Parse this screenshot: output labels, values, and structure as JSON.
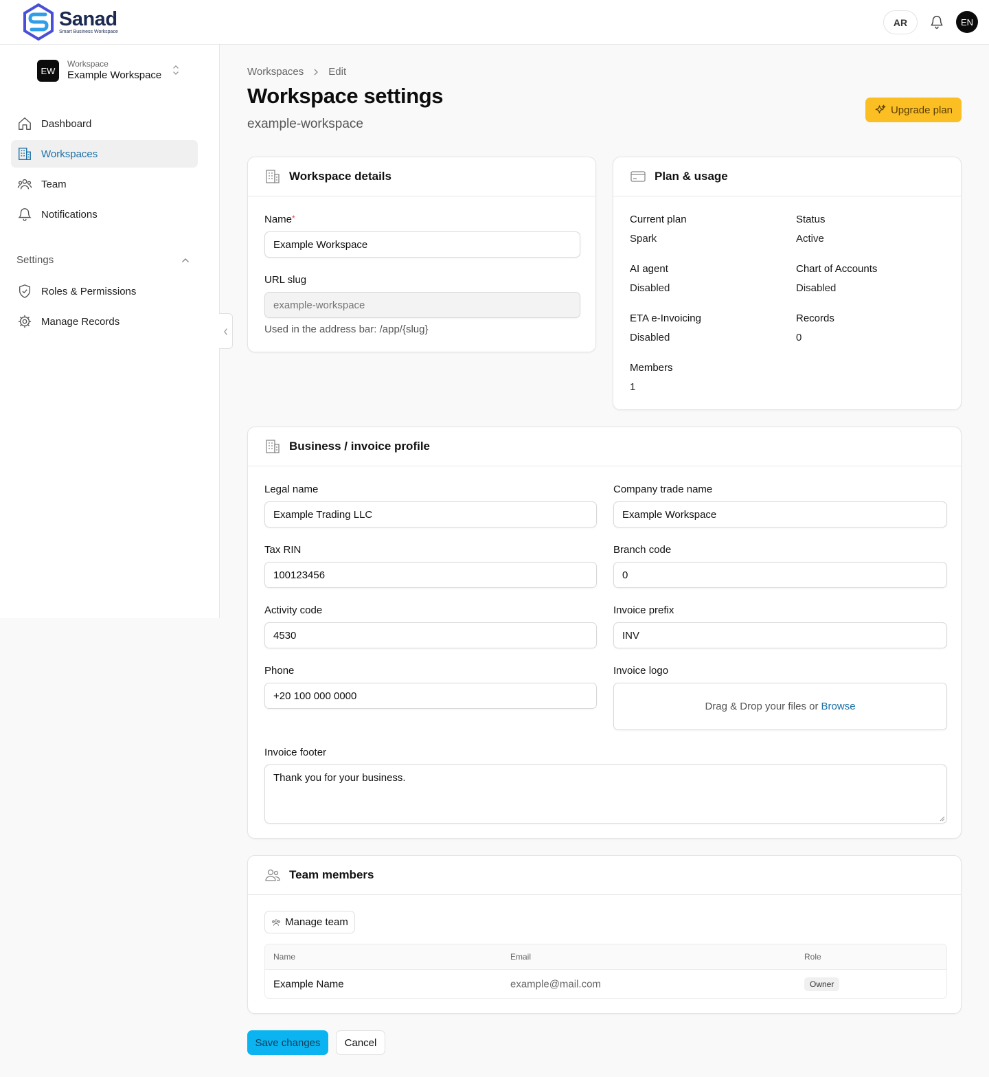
{
  "brand": {
    "name": "Sanad",
    "tagline": "Smart Business Workspace"
  },
  "topbar": {
    "lang_button": "AR",
    "user_initials": "EN"
  },
  "sidebar": {
    "workspace_label": "Workspace",
    "workspace_name": "Example Workspace",
    "workspace_initials": "EW",
    "nav": [
      {
        "label": "Dashboard",
        "icon": "home-icon"
      },
      {
        "label": "Workspaces",
        "icon": "building-icon",
        "active": true
      },
      {
        "label": "Team",
        "icon": "users-icon"
      },
      {
        "label": "Notifications",
        "icon": "bell-icon"
      }
    ],
    "settings_label": "Settings",
    "settings_items": [
      {
        "label": "Roles & Permissions",
        "icon": "shield-check-icon"
      },
      {
        "label": "Manage Records",
        "icon": "gear-icon"
      }
    ]
  },
  "breadcrumb": {
    "root": "Workspaces",
    "current": "Edit"
  },
  "page": {
    "title": "Workspace settings",
    "subtitle": "example-workspace",
    "upgrade_label": "Upgrade plan"
  },
  "workspace_details": {
    "title": "Workspace details",
    "name_label": "Name",
    "name_required_mark": "*",
    "name_value": "Example Workspace",
    "slug_label": "URL slug",
    "slug_placeholder": "example-workspace",
    "slug_hint": "Used in the address bar: /app/{slug}"
  },
  "plan_usage": {
    "title": "Plan & usage",
    "items": [
      {
        "label": "Current plan",
        "value": "Spark"
      },
      {
        "label": "Status",
        "value": "Active"
      },
      {
        "label": "AI agent",
        "value": "Disabled"
      },
      {
        "label": "Chart of Accounts",
        "value": "Disabled"
      },
      {
        "label": "ETA e-Invoicing",
        "value": "Disabled"
      },
      {
        "label": "Records",
        "value": "0"
      },
      {
        "label": "Members",
        "value": "1"
      }
    ]
  },
  "business_profile": {
    "title": "Business / invoice profile",
    "legal_name_label": "Legal name",
    "legal_name_value": "Example Trading LLC",
    "trade_name_label": "Company trade name",
    "trade_name_value": "Example Workspace",
    "tax_rin_label": "Tax RIN",
    "tax_rin_value": "100123456",
    "branch_code_label": "Branch code",
    "branch_code_value": "0",
    "activity_code_label": "Activity code",
    "activity_code_value": "4530",
    "invoice_prefix_label": "Invoice prefix",
    "invoice_prefix_value": "INV",
    "phone_label": "Phone",
    "phone_value": "+20 100 000 0000",
    "invoice_logo_label": "Invoice logo",
    "dropzone_text": "Drag & Drop your files or",
    "dropzone_browse": "Browse",
    "invoice_footer_label": "Invoice footer",
    "invoice_footer_value": "Thank you for your business."
  },
  "team_members": {
    "title": "Team members",
    "manage_label": "Manage team",
    "columns": {
      "name": "Name",
      "email": "Email",
      "role": "Role"
    },
    "rows": [
      {
        "name": "Example Name",
        "email": "example@mail.com",
        "role": "Owner"
      }
    ]
  },
  "actions": {
    "save_label": "Save changes",
    "cancel_label": "Cancel"
  },
  "colors": {
    "accent": "#1a6fa5",
    "upgrade": "#fbbf24",
    "save": "#0bb4f0"
  }
}
